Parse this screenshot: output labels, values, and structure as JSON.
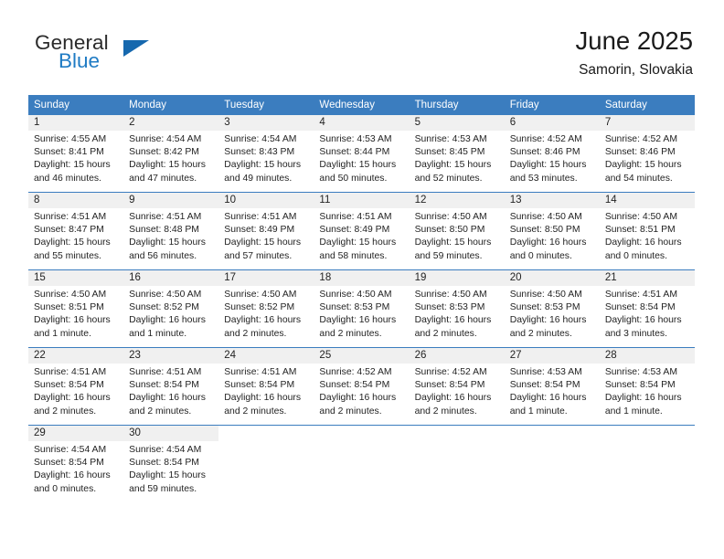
{
  "brand": {
    "name_part1": "General",
    "name_part2": "Blue",
    "triangle_color": "#1668ae",
    "blue_color": "#1f7bc4"
  },
  "header": {
    "title": "June 2025",
    "subtitle": "Samorin, Slovakia"
  },
  "theme": {
    "header_bg": "#3b7dbf",
    "header_text": "#ffffff",
    "daynum_band_bg": "#f0f0f0",
    "row_divider": "#3b7dbf",
    "body_text": "#232323"
  },
  "calendar": {
    "weekday_headers": [
      "Sunday",
      "Monday",
      "Tuesday",
      "Wednesday",
      "Thursday",
      "Friday",
      "Saturday"
    ],
    "weeks": [
      [
        {
          "day": "1",
          "sunrise": "Sunrise: 4:55 AM",
          "sunset": "Sunset: 8:41 PM",
          "daylight_line1": "Daylight: 15 hours",
          "daylight_line2": "and 46 minutes."
        },
        {
          "day": "2",
          "sunrise": "Sunrise: 4:54 AM",
          "sunset": "Sunset: 8:42 PM",
          "daylight_line1": "Daylight: 15 hours",
          "daylight_line2": "and 47 minutes."
        },
        {
          "day": "3",
          "sunrise": "Sunrise: 4:54 AM",
          "sunset": "Sunset: 8:43 PM",
          "daylight_line1": "Daylight: 15 hours",
          "daylight_line2": "and 49 minutes."
        },
        {
          "day": "4",
          "sunrise": "Sunrise: 4:53 AM",
          "sunset": "Sunset: 8:44 PM",
          "daylight_line1": "Daylight: 15 hours",
          "daylight_line2": "and 50 minutes."
        },
        {
          "day": "5",
          "sunrise": "Sunrise: 4:53 AM",
          "sunset": "Sunset: 8:45 PM",
          "daylight_line1": "Daylight: 15 hours",
          "daylight_line2": "and 52 minutes."
        },
        {
          "day": "6",
          "sunrise": "Sunrise: 4:52 AM",
          "sunset": "Sunset: 8:46 PM",
          "daylight_line1": "Daylight: 15 hours",
          "daylight_line2": "and 53 minutes."
        },
        {
          "day": "7",
          "sunrise": "Sunrise: 4:52 AM",
          "sunset": "Sunset: 8:46 PM",
          "daylight_line1": "Daylight: 15 hours",
          "daylight_line2": "and 54 minutes."
        }
      ],
      [
        {
          "day": "8",
          "sunrise": "Sunrise: 4:51 AM",
          "sunset": "Sunset: 8:47 PM",
          "daylight_line1": "Daylight: 15 hours",
          "daylight_line2": "and 55 minutes."
        },
        {
          "day": "9",
          "sunrise": "Sunrise: 4:51 AM",
          "sunset": "Sunset: 8:48 PM",
          "daylight_line1": "Daylight: 15 hours",
          "daylight_line2": "and 56 minutes."
        },
        {
          "day": "10",
          "sunrise": "Sunrise: 4:51 AM",
          "sunset": "Sunset: 8:49 PM",
          "daylight_line1": "Daylight: 15 hours",
          "daylight_line2": "and 57 minutes."
        },
        {
          "day": "11",
          "sunrise": "Sunrise: 4:51 AM",
          "sunset": "Sunset: 8:49 PM",
          "daylight_line1": "Daylight: 15 hours",
          "daylight_line2": "and 58 minutes."
        },
        {
          "day": "12",
          "sunrise": "Sunrise: 4:50 AM",
          "sunset": "Sunset: 8:50 PM",
          "daylight_line1": "Daylight: 15 hours",
          "daylight_line2": "and 59 minutes."
        },
        {
          "day": "13",
          "sunrise": "Sunrise: 4:50 AM",
          "sunset": "Sunset: 8:50 PM",
          "daylight_line1": "Daylight: 16 hours",
          "daylight_line2": "and 0 minutes."
        },
        {
          "day": "14",
          "sunrise": "Sunrise: 4:50 AM",
          "sunset": "Sunset: 8:51 PM",
          "daylight_line1": "Daylight: 16 hours",
          "daylight_line2": "and 0 minutes."
        }
      ],
      [
        {
          "day": "15",
          "sunrise": "Sunrise: 4:50 AM",
          "sunset": "Sunset: 8:51 PM",
          "daylight_line1": "Daylight: 16 hours",
          "daylight_line2": "and 1 minute."
        },
        {
          "day": "16",
          "sunrise": "Sunrise: 4:50 AM",
          "sunset": "Sunset: 8:52 PM",
          "daylight_line1": "Daylight: 16 hours",
          "daylight_line2": "and 1 minute."
        },
        {
          "day": "17",
          "sunrise": "Sunrise: 4:50 AM",
          "sunset": "Sunset: 8:52 PM",
          "daylight_line1": "Daylight: 16 hours",
          "daylight_line2": "and 2 minutes."
        },
        {
          "day": "18",
          "sunrise": "Sunrise: 4:50 AM",
          "sunset": "Sunset: 8:53 PM",
          "daylight_line1": "Daylight: 16 hours",
          "daylight_line2": "and 2 minutes."
        },
        {
          "day": "19",
          "sunrise": "Sunrise: 4:50 AM",
          "sunset": "Sunset: 8:53 PM",
          "daylight_line1": "Daylight: 16 hours",
          "daylight_line2": "and 2 minutes."
        },
        {
          "day": "20",
          "sunrise": "Sunrise: 4:50 AM",
          "sunset": "Sunset: 8:53 PM",
          "daylight_line1": "Daylight: 16 hours",
          "daylight_line2": "and 2 minutes."
        },
        {
          "day": "21",
          "sunrise": "Sunrise: 4:51 AM",
          "sunset": "Sunset: 8:54 PM",
          "daylight_line1": "Daylight: 16 hours",
          "daylight_line2": "and 3 minutes."
        }
      ],
      [
        {
          "day": "22",
          "sunrise": "Sunrise: 4:51 AM",
          "sunset": "Sunset: 8:54 PM",
          "daylight_line1": "Daylight: 16 hours",
          "daylight_line2": "and 2 minutes."
        },
        {
          "day": "23",
          "sunrise": "Sunrise: 4:51 AM",
          "sunset": "Sunset: 8:54 PM",
          "daylight_line1": "Daylight: 16 hours",
          "daylight_line2": "and 2 minutes."
        },
        {
          "day": "24",
          "sunrise": "Sunrise: 4:51 AM",
          "sunset": "Sunset: 8:54 PM",
          "daylight_line1": "Daylight: 16 hours",
          "daylight_line2": "and 2 minutes."
        },
        {
          "day": "25",
          "sunrise": "Sunrise: 4:52 AM",
          "sunset": "Sunset: 8:54 PM",
          "daylight_line1": "Daylight: 16 hours",
          "daylight_line2": "and 2 minutes."
        },
        {
          "day": "26",
          "sunrise": "Sunrise: 4:52 AM",
          "sunset": "Sunset: 8:54 PM",
          "daylight_line1": "Daylight: 16 hours",
          "daylight_line2": "and 2 minutes."
        },
        {
          "day": "27",
          "sunrise": "Sunrise: 4:53 AM",
          "sunset": "Sunset: 8:54 PM",
          "daylight_line1": "Daylight: 16 hours",
          "daylight_line2": "and 1 minute."
        },
        {
          "day": "28",
          "sunrise": "Sunrise: 4:53 AM",
          "sunset": "Sunset: 8:54 PM",
          "daylight_line1": "Daylight: 16 hours",
          "daylight_line2": "and 1 minute."
        }
      ],
      [
        {
          "day": "29",
          "sunrise": "Sunrise: 4:54 AM",
          "sunset": "Sunset: 8:54 PM",
          "daylight_line1": "Daylight: 16 hours",
          "daylight_line2": "and 0 minutes."
        },
        {
          "day": "30",
          "sunrise": "Sunrise: 4:54 AM",
          "sunset": "Sunset: 8:54 PM",
          "daylight_line1": "Daylight: 15 hours",
          "daylight_line2": "and 59 minutes."
        },
        {
          "day": "",
          "sunrise": "",
          "sunset": "",
          "daylight_line1": "",
          "daylight_line2": ""
        },
        {
          "day": "",
          "sunrise": "",
          "sunset": "",
          "daylight_line1": "",
          "daylight_line2": ""
        },
        {
          "day": "",
          "sunrise": "",
          "sunset": "",
          "daylight_line1": "",
          "daylight_line2": ""
        },
        {
          "day": "",
          "sunrise": "",
          "sunset": "",
          "daylight_line1": "",
          "daylight_line2": ""
        },
        {
          "day": "",
          "sunrise": "",
          "sunset": "",
          "daylight_line1": "",
          "daylight_line2": ""
        }
      ]
    ]
  }
}
